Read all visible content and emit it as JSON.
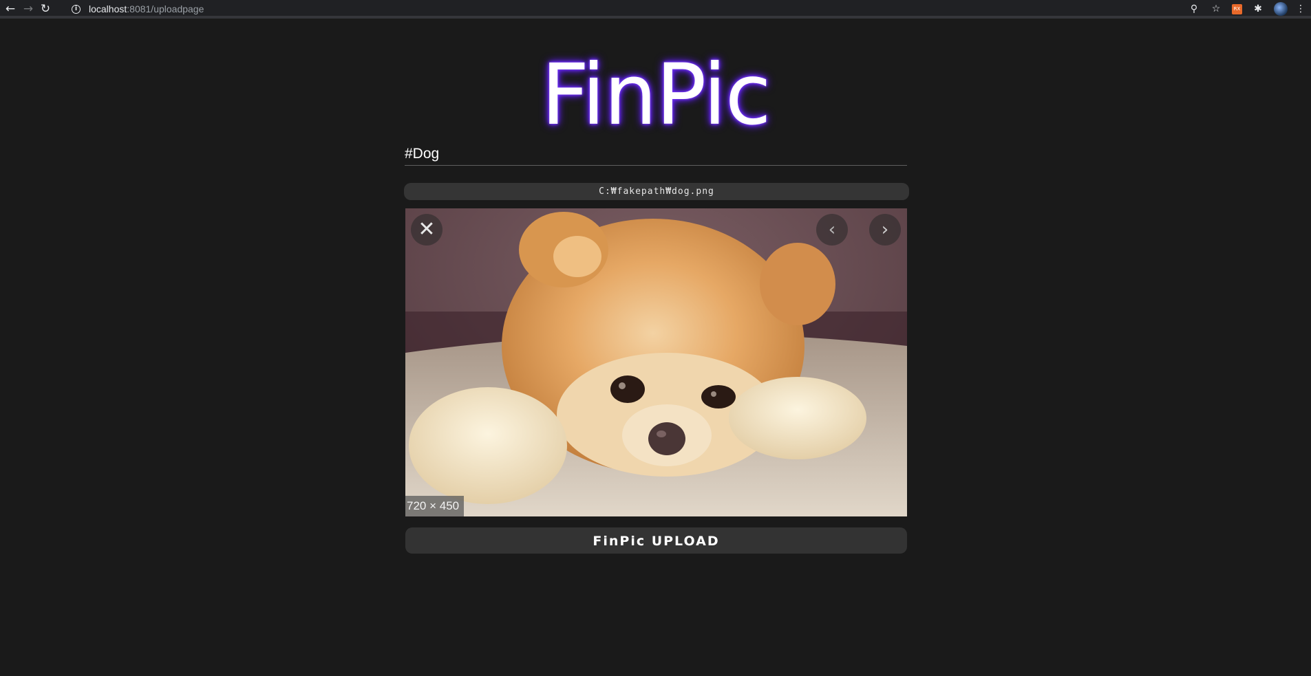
{
  "browser": {
    "url_host": "localhost",
    "url_rest": ":8081/uploadpage",
    "icons": [
      "back-icon",
      "forward-icon",
      "reload-icon",
      "info-icon",
      "zoom-icon",
      "star-icon",
      "extension-icon",
      "puzzle-icon",
      "avatar",
      "menu-icon"
    ],
    "ext_label": "RX"
  },
  "page": {
    "logo_text": "FinPic",
    "logo_glow_color": "#6a2cf5",
    "tag_value": "#Dog",
    "file_path": "C:₩fakepath₩dog.png",
    "preview": {
      "dimensions_label": "720 × 450",
      "close_icon": "close-icon",
      "prev_icon": "chevron-left-icon",
      "next_icon": "chevron-right-icon"
    },
    "upload_label": "FinPic UPLOAD"
  }
}
